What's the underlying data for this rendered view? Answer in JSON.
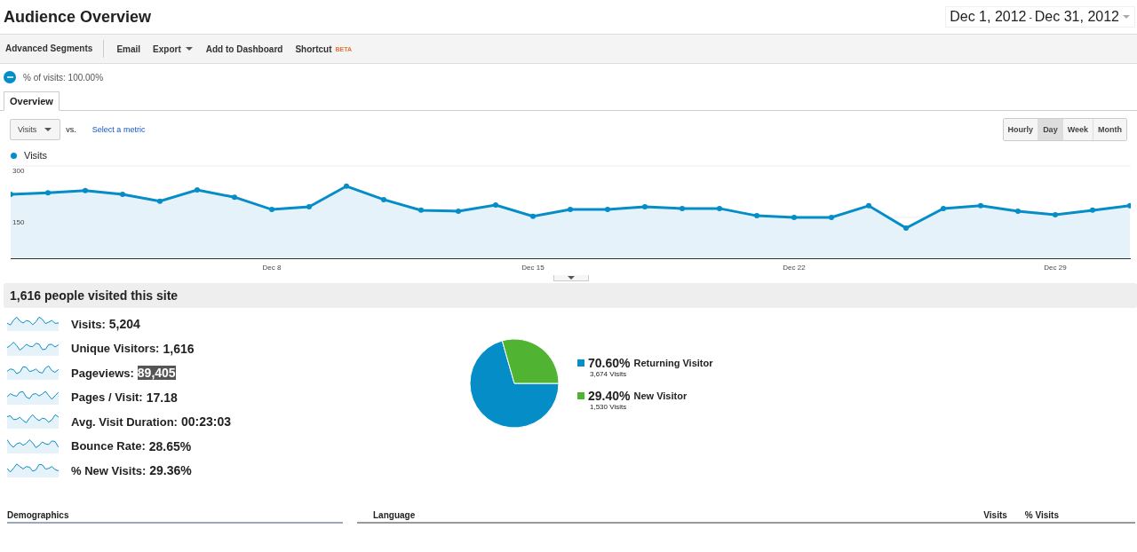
{
  "header": {
    "title": "Audience Overview",
    "date_start": "Dec 1, 2012",
    "date_separator": "-",
    "date_end": "Dec 31, 2012"
  },
  "toolbar": {
    "items": [
      {
        "label": "Advanced Segments",
        "kind": "link"
      },
      {
        "label": "Email",
        "kind": "link"
      },
      {
        "label": "Export",
        "kind": "menu"
      },
      {
        "label": "Add to Dashboard",
        "kind": "link"
      },
      {
        "label": "Shortcut",
        "kind": "beta",
        "badge": "BETA"
      }
    ]
  },
  "segment": {
    "label": "% of visits: 100.00%"
  },
  "tabs": [
    {
      "label": "Overview",
      "selected": true
    }
  ],
  "chart_controls": {
    "metric": "Visits",
    "vs": "vs.",
    "select_metric": "Select a metric",
    "periods": [
      {
        "label": "Hourly",
        "selected": false
      },
      {
        "label": "Day",
        "selected": true
      },
      {
        "label": "Week",
        "selected": false
      },
      {
        "label": "Month",
        "selected": false
      }
    ]
  },
  "main_chart": {
    "chart_data": {
      "type": "area",
      "categories": [
        null,
        null,
        null,
        null,
        null,
        null,
        null,
        "Dec 8",
        null,
        null,
        null,
        null,
        null,
        null,
        "Dec 15",
        null,
        null,
        null,
        null,
        null,
        null,
        "Dec 22",
        null,
        null,
        null,
        null,
        null,
        null,
        "Dec 29",
        null,
        null
      ],
      "series": [
        {
          "name": "Visits",
          "color": "#058dc7",
          "values": [
            217,
            222,
            228,
            217,
            197,
            230,
            209,
            173,
            181,
            241,
            202,
            171,
            168,
            186,
            153,
            173,
            173,
            181,
            176,
            176,
            155,
            150,
            150,
            184,
            119,
            176,
            184,
            168,
            158,
            171,
            184
          ]
        }
      ],
      "ylim": [
        31,
        300
      ],
      "yticks": [
        {
          "value": 150,
          "label": "150"
        },
        {
          "value": 300,
          "label": "300"
        }
      ]
    }
  },
  "summary": {
    "title": "1,616 people visited this site",
    "metrics": [
      {
        "label": "Visits:",
        "value": "5,204",
        "highlighted": false
      },
      {
        "label": "Unique Visitors:",
        "value": "1,616",
        "highlighted": false
      },
      {
        "label": "Pageviews:",
        "value": "89,405",
        "highlighted": true
      },
      {
        "label": "Pages / Visit:",
        "value": "17.18",
        "highlighted": false
      },
      {
        "label": "Avg. Visit Duration:",
        "value": "00:23:03",
        "highlighted": false
      },
      {
        "label": "Bounce Rate:",
        "value": "28.65%",
        "highlighted": false
      },
      {
        "label": "% New Visits:",
        "value": "29.36%",
        "highlighted": false
      }
    ],
    "pie": {
      "chart_data": {
        "type": "pie",
        "categories": [
          "Returning Visitor",
          "New Visitor"
        ],
        "values": [
          70.6,
          29.4
        ]
      },
      "legend": [
        {
          "percent": "70.60%",
          "visits": "3,674 Visits",
          "color": "#058dc7"
        },
        {
          "percent": "29.40%",
          "visits": "1,530 Visits",
          "color": "#50b432"
        }
      ]
    }
  },
  "bottom": {
    "demographics": "Demographics",
    "language": "Language",
    "columns": [
      "Visits",
      "% Visits"
    ]
  }
}
